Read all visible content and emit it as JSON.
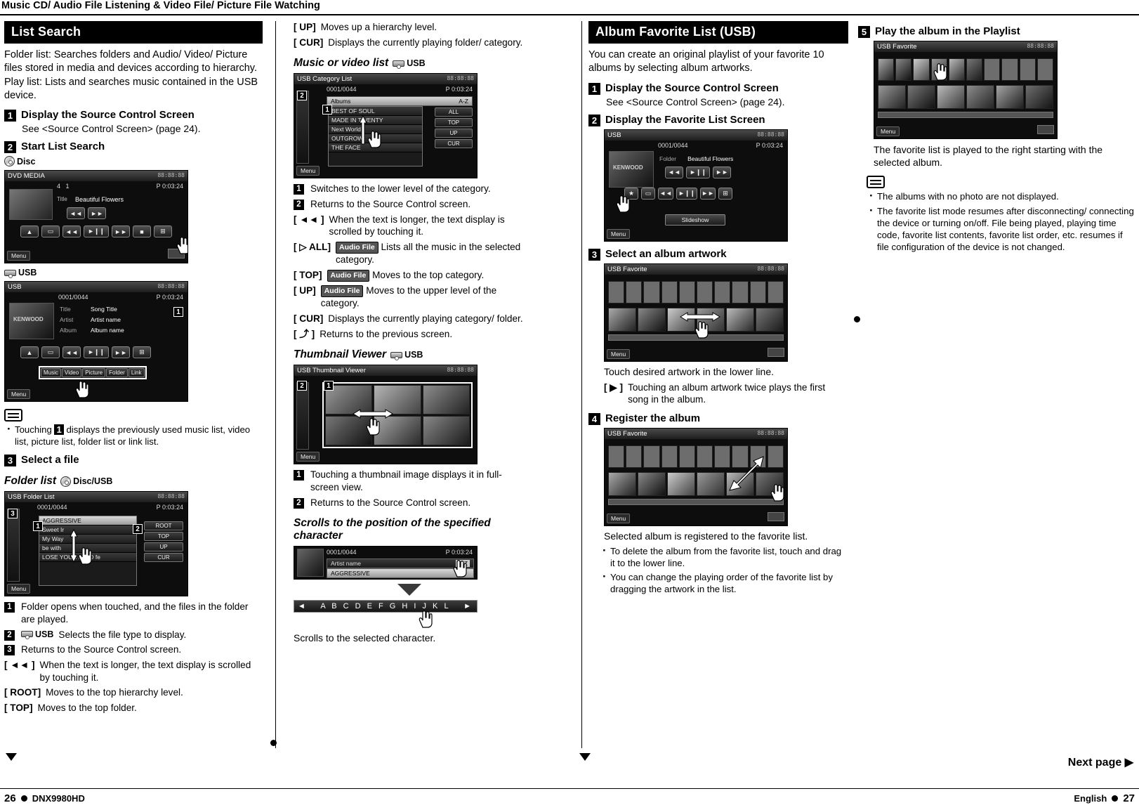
{
  "header": {
    "title": "Music CD/ Audio File Listening & Video File/ Picture File Watching"
  },
  "col1": {
    "section_title": "List Search",
    "intro": "Folder list: Searches folders and Audio/ Video/ Picture files stored in media and devices according to hierarchy.\nPlay list: Lists and searches music contained in the USB device.",
    "step1": {
      "num": "1",
      "title": "Display the Source Control Screen",
      "sub": "See <Source Control Screen> (page 24)."
    },
    "step2": {
      "num": "2",
      "title": "Start List Search"
    },
    "disc_badge": "Disc",
    "usb_badge": "USB",
    "shot_disc": {
      "title": "DVD MEDIA",
      "clock": "88:88:88",
      "track": "4",
      "chapter": "1",
      "time": "P  0:03:24",
      "label_title": "Title",
      "value_title": "Beautiful Flowers",
      "menu": "Menu"
    },
    "shot_usb": {
      "title": "USB",
      "clock": "88:88:88",
      "counter": "0001/0044",
      "time": "P  0:03:24",
      "rows": [
        {
          "label": "Title",
          "value": "Song Title"
        },
        {
          "label": "Artist",
          "value": "Artist name"
        },
        {
          "label": "Album",
          "value": "Album name"
        }
      ],
      "tabs": [
        "Music",
        "Video",
        "Picture",
        "Folder",
        "Link"
      ],
      "menu": "Menu",
      "marker": "1",
      "kenwood": "KENWOOD"
    },
    "note": "Touching 1 displays the previously used music list, video list, picture list, folder list or link list.",
    "step3": {
      "num": "3",
      "title": "Select a file"
    },
    "folder_list_head": "Folder list",
    "folder_badge": "Disc/USB",
    "shot_folder": {
      "title": "Folder List",
      "clock": "88:88:88",
      "counter": "0001/0044",
      "time": "P  0:03:24",
      "highlight": "AGGRESSIVE",
      "items": [
        "Sweet Ir",
        "My Way",
        "be with",
        "LOSE YOUR MIND fe"
      ],
      "buttons": [
        "ROOT",
        "TOP",
        "UP",
        "CUR"
      ],
      "menu": "Menu",
      "markers": [
        "3",
        "1",
        "2"
      ]
    },
    "legend": [
      {
        "num": "1",
        "key": "",
        "text": "Folder opens when touched, and the files in the folder are played."
      },
      {
        "num": "2",
        "key": "USB",
        "text": "Selects the file type to display."
      },
      {
        "num": "3",
        "key": "",
        "text": "Returns to the Source Control screen."
      }
    ],
    "keys": [
      {
        "key": "[ ◄◄ ]",
        "text": "When the text is longer, the text display is scrolled by touching it."
      },
      {
        "key": "[ ROOT]",
        "text": "Moves to the top hierarchy level."
      },
      {
        "key": "[ TOP]",
        "text": "Moves to the top folder."
      }
    ]
  },
  "col2": {
    "keys_top": [
      {
        "key": "[ UP]",
        "text": "Moves up a hierarchy level."
      },
      {
        "key": "[ CUR]",
        "text": "Displays the currently playing folder/ category."
      }
    ],
    "head_music": "Music or video list",
    "badge_usb": "USB",
    "shot_category": {
      "title": "USB Category List",
      "clock": "88:88:88",
      "counter": "0001/0044",
      "time": "P  0:03:24",
      "row_label": "Albums",
      "az": "A-Z",
      "items": [
        "BEST OF SOUL",
        "MADE IN TWENTY",
        "Next World",
        "OUTGROW",
        "THE FACE"
      ],
      "buttons": [
        "ALL",
        "TOP",
        "UP",
        "CUR"
      ],
      "menu": "Menu",
      "markers": [
        "2",
        "1"
      ]
    },
    "legend_category": [
      {
        "num": "1",
        "text": "Switches to the lower level of the category."
      },
      {
        "num": "2",
        "text": "Returns to the Source Control screen."
      }
    ],
    "keys_category": [
      {
        "key": "[ ◄◄ ]",
        "badge": "",
        "text": "When the text is longer, the text display is scrolled by touching it."
      },
      {
        "key": "[ ▷ ALL]",
        "badge": "Audio File",
        "text": "Lists all the music in the selected category."
      },
      {
        "key": "[ TOP]",
        "badge": "Audio File",
        "text": "Moves to the top category."
      },
      {
        "key": "[ UP]",
        "badge": "Audio File",
        "text": "Moves to the upper level of the category."
      },
      {
        "key": "[ CUR]",
        "badge": "",
        "text": "Displays the currently playing category/ folder."
      },
      {
        "key": "[ ⤴ ]",
        "badge": "",
        "text": "Returns to the previous screen."
      }
    ],
    "head_thumb": "Thumbnail Viewer",
    "shot_thumb": {
      "title": "USB Thumbnail Viewer",
      "clock": "88:88:88",
      "menu": "Menu",
      "markers": [
        "2",
        "1"
      ]
    },
    "legend_thumb": [
      {
        "num": "1",
        "text": "Touching a thumbnail image displays it in full-screen view."
      },
      {
        "num": "2",
        "text": "Returns to the Source Control screen."
      }
    ],
    "head_scroll": "Scrolls to the position of the specified character",
    "shot_scroll": {
      "counter": "0001/0044",
      "time": "P  0:03:24",
      "artist": "Artist name",
      "az": "A-Z",
      "highlight": "AGGRESSIVE"
    },
    "charbar": "A  B  C  D  E  F  G  H  I  J  K  L",
    "scroll_caption": "Scrolls to the selected character."
  },
  "col3": {
    "section_title": "Album Favorite List (USB)",
    "intro": "You can create an original playlist of your favorite 10 albums by selecting album artworks.",
    "step1": {
      "num": "1",
      "title": "Display the Source Control Screen",
      "sub": "See <Source Control Screen> (page 24)."
    },
    "step2": {
      "num": "2",
      "title": "Display the Favorite List Screen"
    },
    "shot_fav_src": {
      "title": "USB",
      "clock": "88:88:88",
      "counter": "0001/0044",
      "time": "P  0:03:24",
      "label": "Folder",
      "value": "Beautiful Flowers",
      "slideshow": "Slideshow",
      "menu": "Menu",
      "kenwood": "KENWOOD"
    },
    "step3": {
      "num": "3",
      "title": "Select an album artwork"
    },
    "shot_fav_select": {
      "title": "USB Favorite",
      "clock": "88:88:88",
      "menu": "Menu"
    },
    "caption_select": "Touch desired artwork in the lower line.",
    "key_play": {
      "key": "[ ▶ ]",
      "text": "Touching an album artwork twice plays the first song in the album."
    },
    "step4": {
      "num": "4",
      "title": "Register the album"
    },
    "shot_fav_register": {
      "title": "USB Favorite",
      "clock": "88:88:88",
      "menu": "Menu"
    },
    "caption_register": "Selected album is registered to the favorite list.",
    "notes": [
      "To delete the album from the favorite list, touch and drag it to the lower line.",
      "You can change the playing order of the favorite list by dragging the artwork in the list."
    ]
  },
  "col4": {
    "step5": {
      "num": "5",
      "title": "Play the album in the Playlist"
    },
    "shot_playlist": {
      "title": "USB Favorite",
      "clock": "88:88:88",
      "menu": "Menu"
    },
    "caption": "The favorite list is played to the right starting with the selected album.",
    "notes": [
      "The albums with no photo are not displayed.",
      "The favorite list mode resumes after disconnecting/ connecting the device or turning on/off. File being played, playing time code, favorite list contents, favorite list order, etc. resumes if file configuration of the device is not changed."
    ]
  },
  "footer": {
    "next_page": "Next page ▶",
    "left_page": "26",
    "model": "DNX9980HD",
    "language": "English",
    "right_page": "27"
  }
}
